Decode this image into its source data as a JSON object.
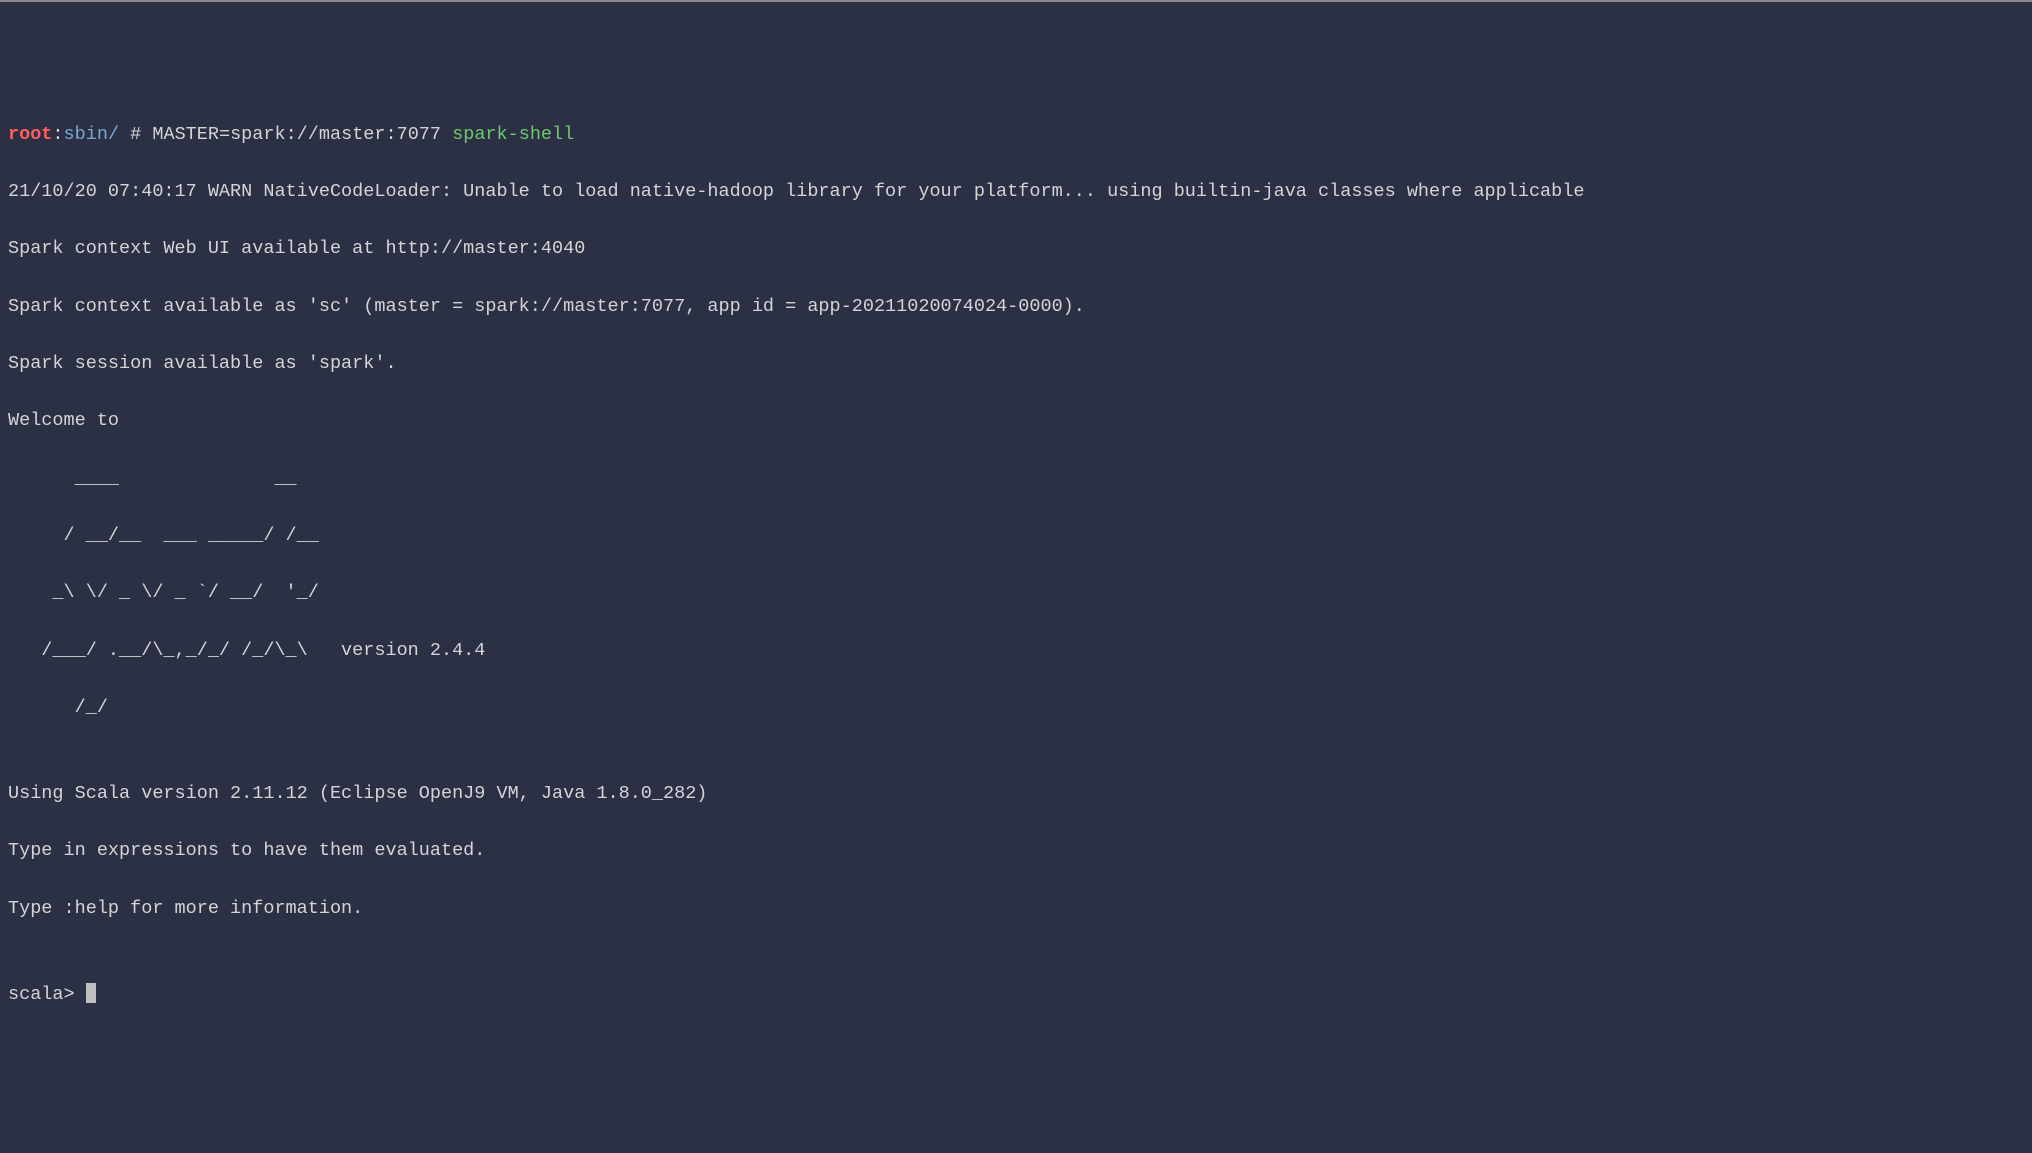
{
  "prompt": {
    "user": "root",
    "colon": ":",
    "path": "sbin/",
    "hash": " # ",
    "env": "MASTER=spark://master:7077 ",
    "cmd": "spark-shell"
  },
  "lines": {
    "warn": "21/10/20 07:40:17 WARN NativeCodeLoader: Unable to load native-hadoop library for your platform... using builtin-java classes where applicable",
    "webui": "Spark context Web UI available at http://master:4040",
    "context": "Spark context available as 'sc' (master = spark://master:7077, app id = app-20211020074024-0000).",
    "session": "Spark session available as 'spark'.",
    "welcome": "Welcome to",
    "ascii1": "      ____              __",
    "ascii2": "     / __/__  ___ _____/ /__",
    "ascii3": "    _\\ \\/ _ \\/ _ `/ __/  '_/",
    "ascii4": "   /___/ .__/\\_,_/_/ /_/\\_\\   version 2.4.4",
    "ascii5": "      /_/",
    "blank1": "",
    "scala": "Using Scala version 2.11.12 (Eclipse OpenJ9 VM, Java 1.8.0_282)",
    "expr": "Type in expressions to have them evaluated.",
    "help": "Type :help for more information.",
    "blank2": "",
    "repl": "scala> "
  }
}
